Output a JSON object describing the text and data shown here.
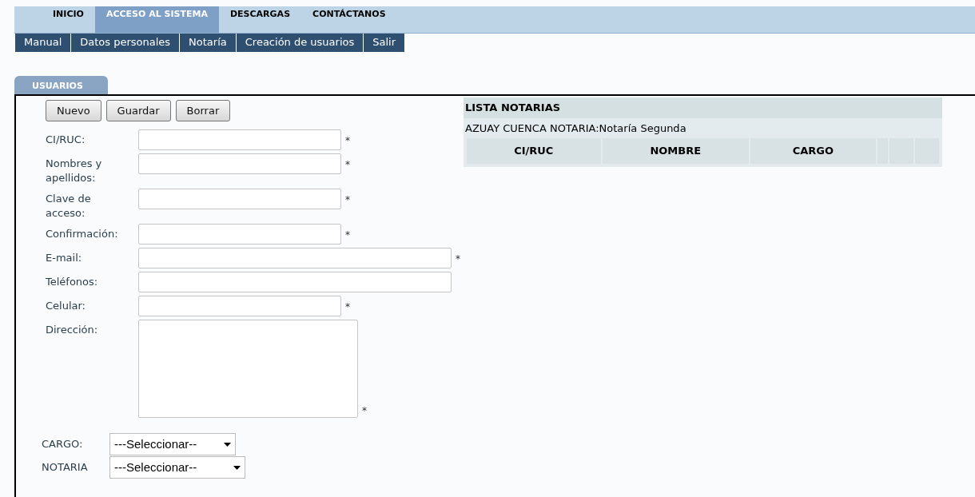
{
  "top_nav": [
    {
      "label": "INICIO",
      "selected": false
    },
    {
      "label": "ACCESO AL SISTEMA",
      "selected": true
    },
    {
      "label": "DESCARGAS",
      "selected": false
    },
    {
      "label": "CONTÁCTANOS",
      "selected": false
    }
  ],
  "sub_menu": [
    "Manual",
    "Datos personales",
    "Notaría",
    "Creación de usuarios",
    "Salir"
  ],
  "tab": {
    "label": "USUARIOS",
    "selected": true
  },
  "buttons": [
    "Nuevo",
    "Guardar",
    "Borrar"
  ],
  "fields": [
    {
      "label": "CI/RUC:",
      "kind": "text",
      "required": true
    },
    {
      "label": "Nombres y apellidos:",
      "kind": "text",
      "required": true
    },
    {
      "label": "Clave de acceso:",
      "kind": "text",
      "required": true
    },
    {
      "label": "Confirmación:",
      "kind": "text",
      "required": true
    },
    {
      "label": "E-mail:",
      "kind": "wide",
      "required": true
    },
    {
      "label": "Teléfonos:",
      "kind": "wide",
      "required": false
    },
    {
      "label": "Celular:",
      "kind": "text",
      "required": true
    },
    {
      "label": "Dirección:",
      "kind": "area",
      "required": true
    }
  ],
  "required_mark": "*",
  "selects": [
    {
      "label": "CARGO:",
      "value": "---Seleccionar--"
    },
    {
      "label": "NOTARIA",
      "value": "---Seleccionar--"
    }
  ],
  "list": {
    "title": "LISTA NOTARIAS",
    "subtitle": "AZUAY CUENCA NOTARIA:Notaría Segunda",
    "columns": [
      "CI/RUC",
      "NOMBRE",
      "CARGO"
    ]
  }
}
